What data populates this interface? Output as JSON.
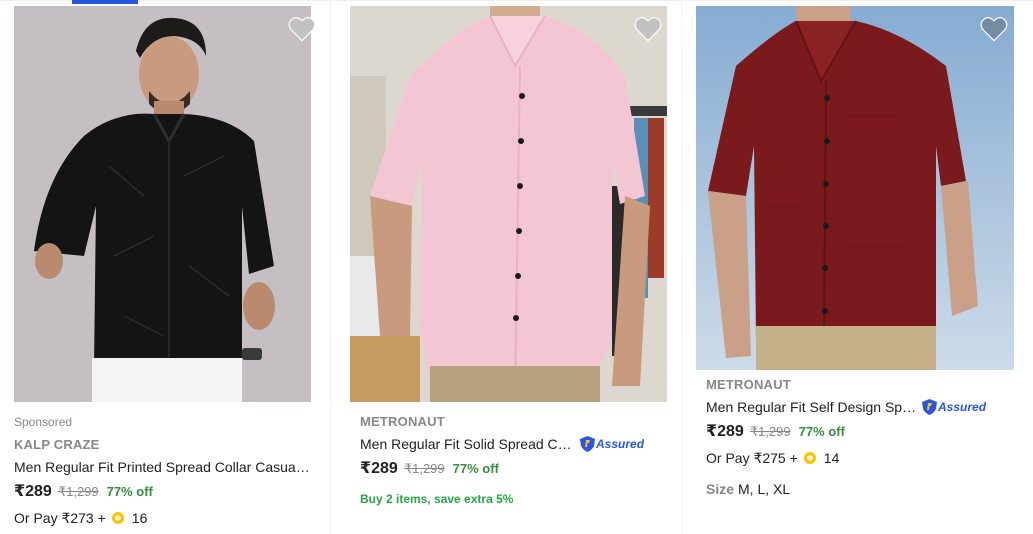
{
  "page": {
    "accent_color": "#2a55e5",
    "price_green": "#388e3c",
    "offer_green": "#26a541",
    "muted_gray": "#878787"
  },
  "products": [
    {
      "sponsored": "Sponsored",
      "brand": "KALP CRAZE",
      "title": "Men Regular Fit Printed Spread Collar Casual Shirt",
      "price": "₹289",
      "mrp": "₹1,299",
      "discount": "77% off",
      "or_pay": "Or Pay ₹273 +",
      "coins": "16",
      "wishlist_icon": "heart-icon",
      "image_icon": "product-image"
    },
    {
      "brand": "METRONAUT",
      "title": "Men Regular Fit Solid Spread Collar Casual Shirt",
      "assured": "Assured",
      "price": "₹289",
      "mrp": "₹1,299",
      "discount": "77% off",
      "offer": "Buy 2 items, save extra 5%",
      "wishlist_icon": "heart-icon",
      "image_icon": "product-image"
    },
    {
      "brand": "METRONAUT",
      "title": "Men Regular Fit Self Design Spread Collar Casual Shirt",
      "assured": "Assured",
      "price": "₹289",
      "mrp": "₹1,299",
      "discount": "77% off",
      "or_pay": "Or Pay ₹275 +",
      "coins": "14",
      "size_label": "Size",
      "sizes": "M, L, XL",
      "wishlist_icon": "heart-icon",
      "image_icon": "product-image"
    }
  ]
}
